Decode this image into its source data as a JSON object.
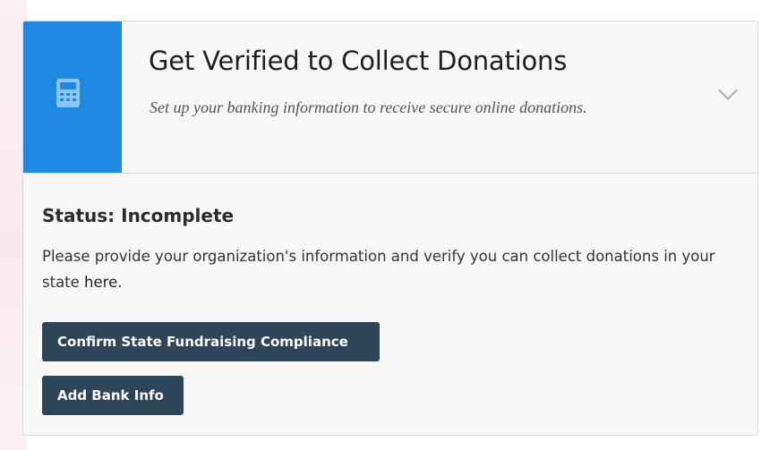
{
  "card": {
    "title": "Get Verified to Collect Donations",
    "subtitle": "Set up your banking information to receive secure online donations.",
    "icon": "calculator-icon",
    "toggle_icon": "chevron-down-icon",
    "accent_color": "#1f88e0"
  },
  "status": {
    "title": "Status: Incomplete",
    "description": "Please provide your organization's information and verify you can collect donations in your state ",
    "link_text": "here",
    "trailing": "."
  },
  "buttons": {
    "compliance_label": "Confirm State Fundraising Compliance",
    "bank_label": "Add Bank Info",
    "color": "#2e4459"
  }
}
